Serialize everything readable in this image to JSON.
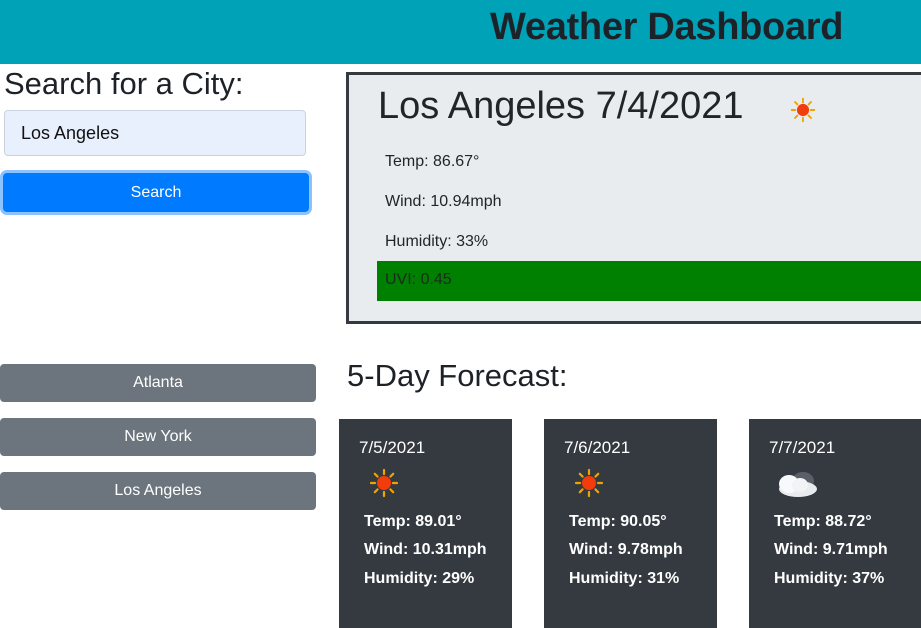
{
  "header": {
    "title": "Weather Dashboard"
  },
  "search": {
    "title": "Search for a City:",
    "value": "Los Angeles",
    "button_label": "Search"
  },
  "history": [
    {
      "label": "Atlanta"
    },
    {
      "label": "New York"
    },
    {
      "label": "Los Angeles"
    }
  ],
  "current": {
    "title": "Los Angeles 7/4/2021",
    "icon": "sunny-icon",
    "temp": "Temp: 86.67°",
    "wind": "Wind: 10.94mph",
    "humidity": "Humidity: 33%",
    "uvi": "UVI: 0.45",
    "uvi_color": "#008000"
  },
  "forecast": {
    "title": "5-Day Forecast:",
    "days": [
      {
        "date": "7/5/2021",
        "icon": "sunny-icon",
        "temp": "Temp: 89.01°",
        "wind": "Wind: 10.31mph",
        "humidity": "Humidity: 29%"
      },
      {
        "date": "7/6/2021",
        "icon": "sunny-icon",
        "temp": "Temp: 90.05°",
        "wind": "Wind: 9.78mph",
        "humidity": "Humidity: 31%"
      },
      {
        "date": "7/7/2021",
        "icon": "cloudy-icon",
        "temp": "Temp: 88.72°",
        "wind": "Wind: 9.71mph",
        "humidity": "Humidity: 37%"
      }
    ]
  },
  "colors": {
    "header": "#00a2b8",
    "primary": "#007bff",
    "secondary": "#6c757d",
    "card": "#343a40"
  }
}
